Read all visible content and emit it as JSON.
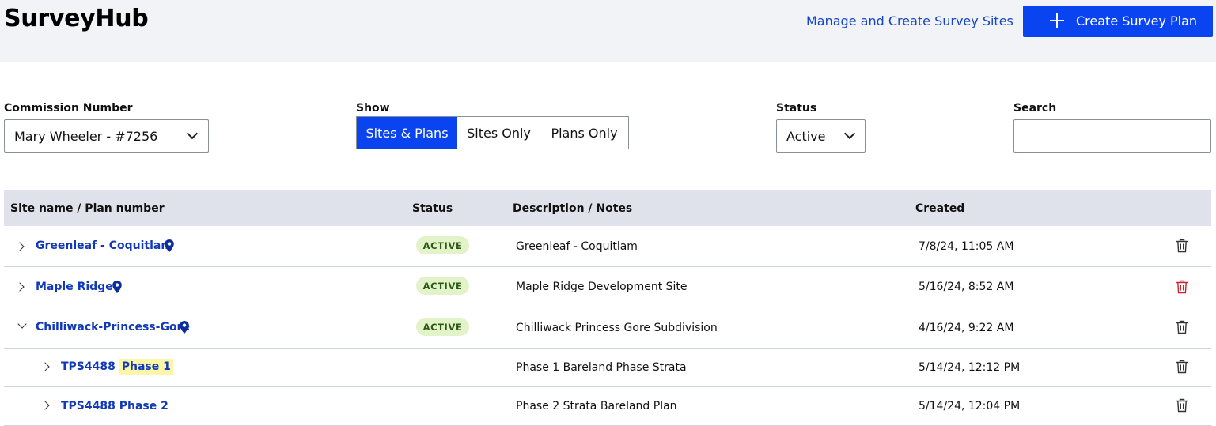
{
  "header": {
    "brand": "SurveyHub",
    "manage_link": "Manage and Create Survey Sites",
    "create_button": "Create Survey Plan"
  },
  "filters": {
    "commission": {
      "label": "Commission Number",
      "value": "Mary Wheeler - #7256"
    },
    "show": {
      "label": "Show",
      "options": [
        "Sites & Plans",
        "Sites Only",
        "Plans Only"
      ],
      "selected": "Sites & Plans"
    },
    "status": {
      "label": "Status",
      "value": "Active"
    },
    "search": {
      "label": "Search",
      "value": "",
      "placeholder": ""
    }
  },
  "table": {
    "columns": [
      "Site name / Plan number",
      "Status",
      "Description / Notes",
      "Created"
    ],
    "rows": [
      {
        "name": "Greenleaf - Coquitlam",
        "status": "ACTIVE",
        "description": "Greenleaf - Coquitlam",
        "created": "7/8/24, 11:05 AM"
      },
      {
        "name": "Maple Ridge",
        "status": "ACTIVE",
        "description": "Maple Ridge Development Site",
        "created": "5/16/24, 8:52 AM"
      },
      {
        "name": "Chilliwack-Princess-Gore",
        "status": "ACTIVE",
        "description": "Chilliwack Princess Gore Subdivision",
        "created": "4/16/24, 9:22 AM"
      }
    ],
    "plans": [
      {
        "name_prefix": "TPS4488",
        "name_highlight": "Phase 1",
        "description": "Phase 1 Bareland Phase Strata",
        "created": "5/14/24, 12:12 PM"
      },
      {
        "name": "TPS4488 Phase 2",
        "description": "Phase 2 Strata Bareland Plan",
        "created": "5/14/24, 12:04 PM"
      }
    ]
  },
  "colors": {
    "primary": "#0a44f0",
    "link": "#1239b8",
    "badge_bg": "#e2f2c9",
    "badge_text": "#2c5a12",
    "danger": "#d0202a",
    "highlight": "#fbf6a8"
  },
  "icons": [
    "plus-icon",
    "chevron-down-icon",
    "chevron-right-icon",
    "location-pin-icon",
    "trash-icon"
  ]
}
